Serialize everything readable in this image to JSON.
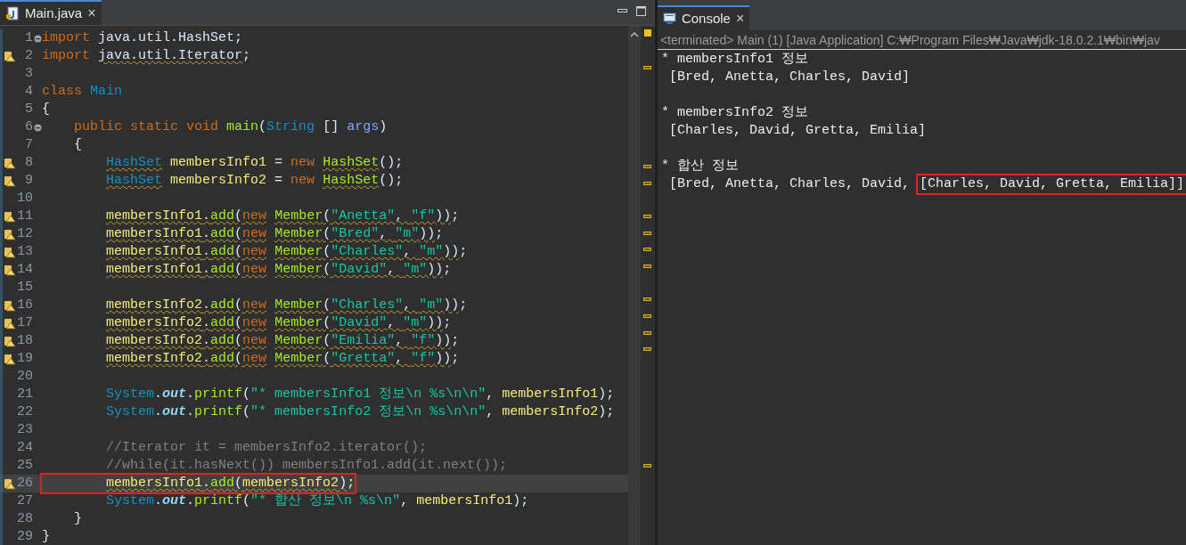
{
  "editor": {
    "tab": {
      "label": "Main.java",
      "close": "×",
      "selected": true
    },
    "lines": [
      {
        "number": "1",
        "fold": true,
        "warning": false,
        "current": false,
        "boxed": false,
        "tokens": [
          {
            "t": "import",
            "kind": "keyword",
            "underlined": false
          },
          {
            "t": " java.util.HashSet;",
            "kind": "plain",
            "underlined": false
          }
        ]
      },
      {
        "number": "2",
        "fold": false,
        "warning": true,
        "current": false,
        "boxed": false,
        "tokens": [
          {
            "t": "import",
            "kind": "keyword",
            "underlined": false
          },
          {
            "t": " java.util.Iterator",
            "kind": "plain",
            "underlined": true
          },
          {
            "t": ";",
            "kind": "plain",
            "underlined": false
          }
        ]
      },
      {
        "number": "3",
        "fold": false,
        "warning": false,
        "current": false,
        "boxed": false
      },
      {
        "number": "4",
        "fold": false,
        "warning": false,
        "current": false,
        "boxed": false,
        "tokens": [
          {
            "t": "class",
            "kind": "keyword",
            "underlined": false
          },
          {
            "t": " Main",
            "kind": "type",
            "underlined": false
          }
        ]
      },
      {
        "number": "5",
        "fold": false,
        "warning": false,
        "current": false,
        "boxed": false,
        "tokens": [
          {
            "t": "{",
            "kind": "plain",
            "underlined": false
          }
        ]
      },
      {
        "number": "6",
        "fold": true,
        "warning": false,
        "current": false,
        "boxed": false,
        "tokens": [
          {
            "t": "    public static void",
            "kind": "keyword",
            "underlined": false
          },
          {
            "t": " main",
            "kind": "method",
            "underlined": false
          },
          {
            "t": "(",
            "kind": "plain",
            "underlined": false
          },
          {
            "t": "String",
            "kind": "type",
            "underlined": false
          },
          {
            "t": " [] ",
            "kind": "plain",
            "underlined": false
          },
          {
            "t": "args",
            "kind": "param",
            "underlined": false
          },
          {
            "t": ")",
            "kind": "plain",
            "underlined": false
          }
        ]
      },
      {
        "number": "7",
        "fold": false,
        "warning": false,
        "current": false,
        "boxed": false,
        "tokens": [
          {
            "t": "    {",
            "kind": "plain",
            "underlined": false
          }
        ]
      },
      {
        "number": "8",
        "fold": false,
        "warning": true,
        "current": false,
        "boxed": false,
        "tokens": [
          {
            "t": "        HashSet",
            "kind": "type",
            "underlined": true
          },
          {
            "t": " membersInfo1",
            "kind": "variable",
            "underlined": false
          },
          {
            "t": " = ",
            "kind": "plain",
            "underlined": false
          },
          {
            "t": "new",
            "kind": "keyword",
            "underlined": false
          },
          {
            "t": " HashSet",
            "kind": "method",
            "underlined": true
          },
          {
            "t": "();",
            "kind": "plain",
            "underlined": false
          }
        ]
      },
      {
        "number": "9",
        "fold": false,
        "warning": true,
        "current": false,
        "boxed": false,
        "tokens": [
          {
            "t": "        HashSet",
            "kind": "type",
            "underlined": true
          },
          {
            "t": " membersInfo2",
            "kind": "variable",
            "underlined": false
          },
          {
            "t": " = ",
            "kind": "plain",
            "underlined": false
          },
          {
            "t": "new",
            "kind": "keyword",
            "underlined": false
          },
          {
            "t": " HashSet",
            "kind": "method",
            "underlined": true
          },
          {
            "t": "();",
            "kind": "plain",
            "underlined": false
          }
        ]
      },
      {
        "number": "10",
        "fold": false,
        "warning": false,
        "current": false,
        "boxed": false
      },
      {
        "number": "11",
        "fold": false,
        "warning": true,
        "current": false,
        "boxed": false,
        "tokens": [
          {
            "t": "        membersInfo1",
            "kind": "variable",
            "underlined": true
          },
          {
            "t": ".",
            "kind": "plain",
            "underlined": true
          },
          {
            "t": "add",
            "kind": "method",
            "underlined": true
          },
          {
            "t": "(",
            "kind": "plain",
            "underlined": true
          },
          {
            "t": "new",
            "kind": "keyword",
            "underlined": true
          },
          {
            "t": " Member",
            "kind": "method",
            "underlined": true
          },
          {
            "t": "(",
            "kind": "plain",
            "underlined": true
          },
          {
            "t": "\"Anetta\"",
            "kind": "string",
            "underlined": true
          },
          {
            "t": ", ",
            "kind": "plain",
            "underlined": true
          },
          {
            "t": "\"f\"",
            "kind": "string",
            "underlined": true
          },
          {
            "t": "))",
            "kind": "plain",
            "underlined": true
          },
          {
            "t": ";",
            "kind": "plain",
            "underlined": false
          }
        ]
      },
      {
        "number": "12",
        "fold": false,
        "warning": true,
        "current": false,
        "boxed": false,
        "tokens": [
          {
            "t": "        membersInfo1",
            "kind": "variable",
            "underlined": true
          },
          {
            "t": ".",
            "kind": "plain",
            "underlined": true
          },
          {
            "t": "add",
            "kind": "method",
            "underlined": true
          },
          {
            "t": "(",
            "kind": "plain",
            "underlined": true
          },
          {
            "t": "new",
            "kind": "keyword",
            "underlined": true
          },
          {
            "t": " Member",
            "kind": "method",
            "underlined": true
          },
          {
            "t": "(",
            "kind": "plain",
            "underlined": true
          },
          {
            "t": "\"Bred\"",
            "kind": "string",
            "underlined": true
          },
          {
            "t": ", ",
            "kind": "plain",
            "underlined": true
          },
          {
            "t": "\"m\"",
            "kind": "string",
            "underlined": true
          },
          {
            "t": "))",
            "kind": "plain",
            "underlined": true
          },
          {
            "t": ";",
            "kind": "plain",
            "underlined": false
          }
        ]
      },
      {
        "number": "13",
        "fold": false,
        "warning": true,
        "current": false,
        "boxed": false,
        "tokens": [
          {
            "t": "        membersInfo1",
            "kind": "variable",
            "underlined": true
          },
          {
            "t": ".",
            "kind": "plain",
            "underlined": true
          },
          {
            "t": "add",
            "kind": "method",
            "underlined": true
          },
          {
            "t": "(",
            "kind": "plain",
            "underlined": true
          },
          {
            "t": "new",
            "kind": "keyword",
            "underlined": true
          },
          {
            "t": " Member",
            "kind": "method",
            "underlined": true
          },
          {
            "t": "(",
            "kind": "plain",
            "underlined": true
          },
          {
            "t": "\"Charles\"",
            "kind": "string",
            "underlined": true
          },
          {
            "t": ", ",
            "kind": "plain",
            "underlined": true
          },
          {
            "t": "\"m\"",
            "kind": "string",
            "underlined": true
          },
          {
            "t": "))",
            "kind": "plain",
            "underlined": true
          },
          {
            "t": ";",
            "kind": "plain",
            "underlined": false
          }
        ]
      },
      {
        "number": "14",
        "fold": false,
        "warning": true,
        "current": false,
        "boxed": false,
        "tokens": [
          {
            "t": "        membersInfo1",
            "kind": "variable",
            "underlined": true
          },
          {
            "t": ".",
            "kind": "plain",
            "underlined": true
          },
          {
            "t": "add",
            "kind": "method",
            "underlined": true
          },
          {
            "t": "(",
            "kind": "plain",
            "underlined": true
          },
          {
            "t": "new",
            "kind": "keyword",
            "underlined": true
          },
          {
            "t": " Member",
            "kind": "method",
            "underlined": true
          },
          {
            "t": "(",
            "kind": "plain",
            "underlined": true
          },
          {
            "t": "\"David\"",
            "kind": "string",
            "underlined": true
          },
          {
            "t": ", ",
            "kind": "plain",
            "underlined": true
          },
          {
            "t": "\"m\"",
            "kind": "string",
            "underlined": true
          },
          {
            "t": "))",
            "kind": "plain",
            "underlined": true
          },
          {
            "t": ";",
            "kind": "plain",
            "underlined": false
          }
        ]
      },
      {
        "number": "15",
        "fold": false,
        "warning": false,
        "current": false,
        "boxed": false
      },
      {
        "number": "16",
        "fold": false,
        "warning": true,
        "current": false,
        "boxed": false,
        "tokens": [
          {
            "t": "        membersInfo2",
            "kind": "variable",
            "underlined": true
          },
          {
            "t": ".",
            "kind": "plain",
            "underlined": true
          },
          {
            "t": "add",
            "kind": "method",
            "underlined": true
          },
          {
            "t": "(",
            "kind": "plain",
            "underlined": true
          },
          {
            "t": "new",
            "kind": "keyword",
            "underlined": true
          },
          {
            "t": " Member",
            "kind": "method",
            "underlined": true
          },
          {
            "t": "(",
            "kind": "plain",
            "underlined": true
          },
          {
            "t": "\"Charles\"",
            "kind": "string",
            "underlined": true
          },
          {
            "t": ", ",
            "kind": "plain",
            "underlined": true
          },
          {
            "t": "\"m\"",
            "kind": "string",
            "underlined": true
          },
          {
            "t": "))",
            "kind": "plain",
            "underlined": true
          },
          {
            "t": ";",
            "kind": "plain",
            "underlined": false
          }
        ]
      },
      {
        "number": "17",
        "fold": false,
        "warning": true,
        "current": false,
        "boxed": false,
        "tokens": [
          {
            "t": "        membersInfo2",
            "kind": "variable",
            "underlined": true
          },
          {
            "t": ".",
            "kind": "plain",
            "underlined": true
          },
          {
            "t": "add",
            "kind": "method",
            "underlined": true
          },
          {
            "t": "(",
            "kind": "plain",
            "underlined": true
          },
          {
            "t": "new",
            "kind": "keyword",
            "underlined": true
          },
          {
            "t": " Member",
            "kind": "method",
            "underlined": true
          },
          {
            "t": "(",
            "kind": "plain",
            "underlined": true
          },
          {
            "t": "\"David\"",
            "kind": "string",
            "underlined": true
          },
          {
            "t": ", ",
            "kind": "plain",
            "underlined": true
          },
          {
            "t": "\"m\"",
            "kind": "string",
            "underlined": true
          },
          {
            "t": "))",
            "kind": "plain",
            "underlined": true
          },
          {
            "t": ";",
            "kind": "plain",
            "underlined": false
          }
        ]
      },
      {
        "number": "18",
        "fold": false,
        "warning": true,
        "current": false,
        "boxed": false,
        "tokens": [
          {
            "t": "        membersInfo2",
            "kind": "variable",
            "underlined": true
          },
          {
            "t": ".",
            "kind": "plain",
            "underlined": true
          },
          {
            "t": "add",
            "kind": "method",
            "underlined": true
          },
          {
            "t": "(",
            "kind": "plain",
            "underlined": true
          },
          {
            "t": "new",
            "kind": "keyword",
            "underlined": true
          },
          {
            "t": " Member",
            "kind": "method",
            "underlined": true
          },
          {
            "t": "(",
            "kind": "plain",
            "underlined": true
          },
          {
            "t": "\"Emilia\"",
            "kind": "string",
            "underlined": true
          },
          {
            "t": ", ",
            "kind": "plain",
            "underlined": true
          },
          {
            "t": "\"f\"",
            "kind": "string",
            "underlined": true
          },
          {
            "t": "))",
            "kind": "plain",
            "underlined": true
          },
          {
            "t": ";",
            "kind": "plain",
            "underlined": false
          }
        ]
      },
      {
        "number": "19",
        "fold": false,
        "warning": true,
        "current": false,
        "boxed": false,
        "tokens": [
          {
            "t": "        membersInfo2",
            "kind": "variable",
            "underlined": true
          },
          {
            "t": ".",
            "kind": "plain",
            "underlined": true
          },
          {
            "t": "add",
            "kind": "method",
            "underlined": true
          },
          {
            "t": "(",
            "kind": "plain",
            "underlined": true
          },
          {
            "t": "new",
            "kind": "keyword",
            "underlined": true
          },
          {
            "t": " Member",
            "kind": "method",
            "underlined": true
          },
          {
            "t": "(",
            "kind": "plain",
            "underlined": true
          },
          {
            "t": "\"Gretta\"",
            "kind": "string",
            "underlined": true
          },
          {
            "t": ", ",
            "kind": "plain",
            "underlined": true
          },
          {
            "t": "\"f\"",
            "kind": "string",
            "underlined": true
          },
          {
            "t": "))",
            "kind": "plain",
            "underlined": true
          },
          {
            "t": ";",
            "kind": "plain",
            "underlined": false
          }
        ]
      },
      {
        "number": "20",
        "fold": false,
        "warning": false,
        "current": false,
        "boxed": false
      },
      {
        "number": "21",
        "fold": false,
        "warning": false,
        "current": false,
        "boxed": false,
        "tokens": [
          {
            "t": "        System",
            "kind": "type",
            "underlined": false
          },
          {
            "t": ".",
            "kind": "plain",
            "underlined": false
          },
          {
            "t": "out",
            "kind": "field",
            "underlined": false
          },
          {
            "t": ".",
            "kind": "plain",
            "underlined": false
          },
          {
            "t": "printf",
            "kind": "method",
            "underlined": false
          },
          {
            "t": "(",
            "kind": "plain",
            "underlined": false
          },
          {
            "t": "\"* membersInfo1 정보\\n %s\\n\\n\"",
            "kind": "string",
            "underlined": false
          },
          {
            "t": ", ",
            "kind": "plain",
            "underlined": false
          },
          {
            "t": "membersInfo1",
            "kind": "variable",
            "underlined": false
          },
          {
            "t": ");",
            "kind": "plain",
            "underlined": false
          }
        ]
      },
      {
        "number": "22",
        "fold": false,
        "warning": false,
        "current": false,
        "boxed": false,
        "tokens": [
          {
            "t": "        System",
            "kind": "type",
            "underlined": false
          },
          {
            "t": ".",
            "kind": "plain",
            "underlined": false
          },
          {
            "t": "out",
            "kind": "field",
            "underlined": false
          },
          {
            "t": ".",
            "kind": "plain",
            "underlined": false
          },
          {
            "t": "printf",
            "kind": "method",
            "underlined": false
          },
          {
            "t": "(",
            "kind": "plain",
            "underlined": false
          },
          {
            "t": "\"* membersInfo2 정보\\n %s\\n\\n\"",
            "kind": "string",
            "underlined": false
          },
          {
            "t": ", ",
            "kind": "plain",
            "underlined": false
          },
          {
            "t": "membersInfo2",
            "kind": "variable",
            "underlined": false
          },
          {
            "t": ");",
            "kind": "plain",
            "underlined": false
          }
        ]
      },
      {
        "number": "23",
        "fold": false,
        "warning": false,
        "current": false,
        "boxed": false
      },
      {
        "number": "24",
        "fold": false,
        "warning": false,
        "current": false,
        "boxed": false,
        "tokens": [
          {
            "t": "        //Iterator it = membersInfo2.iterator();",
            "kind": "comment",
            "underlined": false
          }
        ]
      },
      {
        "number": "25",
        "fold": false,
        "warning": false,
        "current": false,
        "boxed": false,
        "tokens": [
          {
            "t": "        //while(it.hasNext()) membersInfo1.add(it.next());",
            "kind": "comment",
            "underlined": false
          }
        ]
      },
      {
        "number": "26",
        "fold": false,
        "warning": true,
        "current": true,
        "boxed": true,
        "tokens": [
          {
            "t": "        membersInfo1",
            "kind": "variable",
            "underlined": true
          },
          {
            "t": ".",
            "kind": "plain",
            "underlined": true
          },
          {
            "t": "add",
            "kind": "method",
            "underlined": true
          },
          {
            "t": "(",
            "kind": "plain",
            "underlined": true
          },
          {
            "t": "membersInfo2",
            "kind": "variable",
            "underlined": true
          },
          {
            "t": ")",
            "kind": "plain",
            "underlined": true
          },
          {
            "t": ";",
            "kind": "plain",
            "underlined": false
          }
        ]
      },
      {
        "number": "27",
        "fold": false,
        "warning": false,
        "current": false,
        "boxed": false,
        "tokens": [
          {
            "t": "        System",
            "kind": "type",
            "underlined": false
          },
          {
            "t": ".",
            "kind": "plain",
            "underlined": false
          },
          {
            "t": "out",
            "kind": "field",
            "underlined": false
          },
          {
            "t": ".",
            "kind": "plain",
            "underlined": false
          },
          {
            "t": "printf",
            "kind": "method",
            "underlined": false
          },
          {
            "t": "(",
            "kind": "plain",
            "underlined": false
          },
          {
            "t": "\"* 합산 정보\\n %s\\n\"",
            "kind": "string",
            "underlined": false
          },
          {
            "t": ", ",
            "kind": "plain",
            "underlined": false
          },
          {
            "t": "membersInfo1",
            "kind": "variable",
            "underlined": false
          },
          {
            "t": ");",
            "kind": "plain",
            "underlined": false
          }
        ]
      },
      {
        "number": "28",
        "fold": false,
        "warning": false,
        "current": false,
        "boxed": false,
        "tokens": [
          {
            "t": "    }",
            "kind": "plain",
            "underlined": false
          }
        ]
      },
      {
        "number": "29",
        "fold": false,
        "warning": false,
        "current": false,
        "boxed": false,
        "tokens": [
          {
            "t": "}",
            "kind": "plain",
            "underlined": false
          }
        ]
      }
    ]
  },
  "console": {
    "tab": {
      "label": "Console",
      "close": "×",
      "selected": true
    },
    "status": "<terminated> Main (1) [Java Application] C:₩Program Files₩Java₩jdk-18.0.2.1₩bin₩jav",
    "blocks": [
      {
        "heading": "* membersInfo1 정보",
        "value": [
          {
            "t": " [Bred, Anetta, Charles, David]",
            "boxed": false
          }
        ]
      },
      {
        "heading": "* membersInfo2 정보",
        "value": [
          {
            "t": " [Charles, David, Gretta, Emilia]",
            "boxed": false
          }
        ]
      },
      {
        "heading": "* 합산 정보",
        "value": [
          {
            "t": " [Bred, Anetta, Charles, David, ",
            "boxed": false
          },
          {
            "t": "[Charles, David, Gretta, Emilia]]",
            "boxed": true
          }
        ]
      }
    ]
  }
}
